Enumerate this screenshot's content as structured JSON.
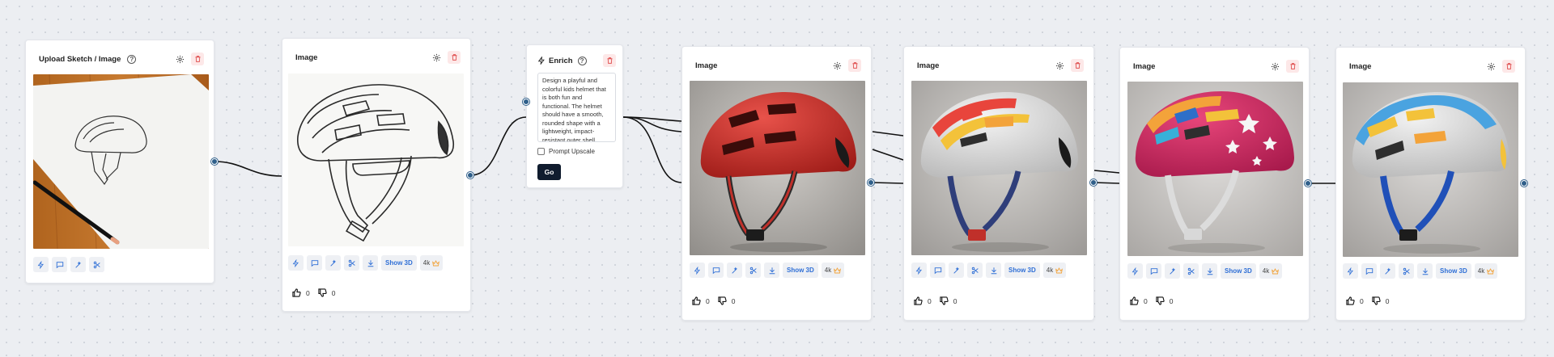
{
  "nodes": {
    "upload": {
      "title": "Upload Sketch / Image",
      "help": "?",
      "tools": [
        "bolt-icon",
        "comment-icon",
        "magic-wand-icon",
        "scissors-icon"
      ]
    },
    "image1": {
      "title": "Image",
      "show3d": "Show 3D",
      "res": "4k",
      "likes": "0",
      "dislikes": "0"
    },
    "enrich": {
      "title": "Enrich",
      "help": "?",
      "prompt": "Design a playful and colorful kids helmet that is both fun and functional. The helmet should have a smooth, rounded shape with a lightweight, impact-resistant outer shell",
      "upscale_label": "Prompt Upscale",
      "go_label": "Go"
    },
    "image2": {
      "title": "Image",
      "show3d": "Show 3D",
      "res": "4k",
      "likes": "0",
      "dislikes": "0"
    },
    "image3": {
      "title": "Image",
      "show3d": "Show 3D",
      "res": "4k",
      "likes": "0",
      "dislikes": "0"
    },
    "image4": {
      "title": "Image",
      "show3d": "Show 3D",
      "res": "4k",
      "likes": "0",
      "dislikes": "0"
    },
    "image5": {
      "title": "Image",
      "show3d": "Show 3D",
      "res": "4k",
      "likes": "0",
      "dislikes": "0"
    }
  },
  "colors": {
    "handle": "#2f5f8a",
    "delete_bg": "#fde8e8",
    "delete_icon": "#e05252",
    "show3d_text": "#2f6fd6",
    "go_bg": "#101c2e",
    "crown": "#f2a33a"
  }
}
